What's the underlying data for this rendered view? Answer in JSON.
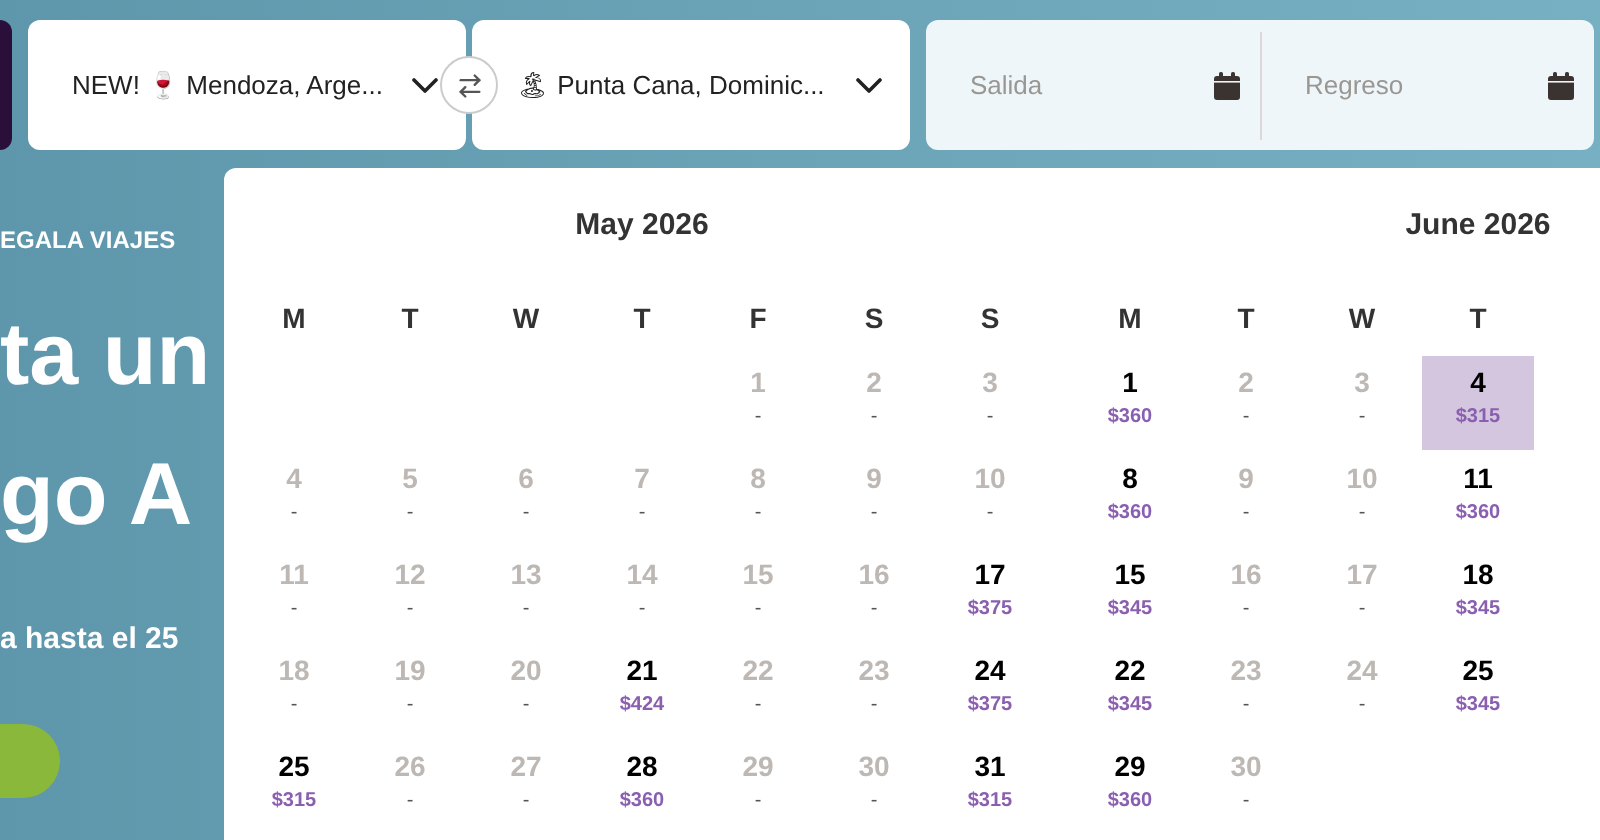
{
  "search": {
    "origin": {
      "label": "NEW! 🍷 Mendoza, Arge..."
    },
    "destination": {
      "label": "🏝 Punta Cana, Dominic..."
    },
    "departure": {
      "placeholder": "Salida"
    },
    "return": {
      "placeholder": "Regreso"
    }
  },
  "hero": {
    "eyebrow": "EGALA VIAJES",
    "headline_lines": [
      "ta un",
      "go A"
    ],
    "subtitle": "a hasta el 25"
  },
  "months": [
    {
      "title": "May 2026",
      "weekdays": [
        "M",
        "T",
        "W",
        "T",
        "F",
        "S",
        "S"
      ],
      "weeks": [
        [
          {
            "kind": "blank"
          },
          {
            "kind": "blank"
          },
          {
            "kind": "blank"
          },
          {
            "kind": "blank"
          },
          {
            "kind": "day",
            "day": "1",
            "price": "-",
            "available": false,
            "selected": false
          },
          {
            "kind": "day",
            "day": "2",
            "price": "-",
            "available": false,
            "selected": false
          },
          {
            "kind": "day",
            "day": "3",
            "price": "-",
            "available": false,
            "selected": false
          }
        ],
        [
          {
            "kind": "day",
            "day": "4",
            "price": "-",
            "available": false,
            "selected": false
          },
          {
            "kind": "day",
            "day": "5",
            "price": "-",
            "available": false,
            "selected": false
          },
          {
            "kind": "day",
            "day": "6",
            "price": "-",
            "available": false,
            "selected": false
          },
          {
            "kind": "day",
            "day": "7",
            "price": "-",
            "available": false,
            "selected": false
          },
          {
            "kind": "day",
            "day": "8",
            "price": "-",
            "available": false,
            "selected": false
          },
          {
            "kind": "day",
            "day": "9",
            "price": "-",
            "available": false,
            "selected": false
          },
          {
            "kind": "day",
            "day": "10",
            "price": "-",
            "available": false,
            "selected": false
          }
        ],
        [
          {
            "kind": "day",
            "day": "11",
            "price": "-",
            "available": false,
            "selected": false
          },
          {
            "kind": "day",
            "day": "12",
            "price": "-",
            "available": false,
            "selected": false
          },
          {
            "kind": "day",
            "day": "13",
            "price": "-",
            "available": false,
            "selected": false
          },
          {
            "kind": "day",
            "day": "14",
            "price": "-",
            "available": false,
            "selected": false
          },
          {
            "kind": "day",
            "day": "15",
            "price": "-",
            "available": false,
            "selected": false
          },
          {
            "kind": "day",
            "day": "16",
            "price": "-",
            "available": false,
            "selected": false
          },
          {
            "kind": "day",
            "day": "17",
            "price": "$375",
            "available": true,
            "selected": false
          }
        ],
        [
          {
            "kind": "day",
            "day": "18",
            "price": "-",
            "available": false,
            "selected": false
          },
          {
            "kind": "day",
            "day": "19",
            "price": "-",
            "available": false,
            "selected": false
          },
          {
            "kind": "day",
            "day": "20",
            "price": "-",
            "available": false,
            "selected": false
          },
          {
            "kind": "day",
            "day": "21",
            "price": "$424",
            "available": true,
            "selected": false
          },
          {
            "kind": "day",
            "day": "22",
            "price": "-",
            "available": false,
            "selected": false
          },
          {
            "kind": "day",
            "day": "23",
            "price": "-",
            "available": false,
            "selected": false
          },
          {
            "kind": "day",
            "day": "24",
            "price": "$375",
            "available": true,
            "selected": false
          }
        ],
        [
          {
            "kind": "day",
            "day": "25",
            "price": "$315",
            "available": true,
            "selected": false
          },
          {
            "kind": "day",
            "day": "26",
            "price": "-",
            "available": false,
            "selected": false
          },
          {
            "kind": "day",
            "day": "27",
            "price": "-",
            "available": false,
            "selected": false
          },
          {
            "kind": "day",
            "day": "28",
            "price": "$360",
            "available": true,
            "selected": false
          },
          {
            "kind": "day",
            "day": "29",
            "price": "-",
            "available": false,
            "selected": false
          },
          {
            "kind": "day",
            "day": "30",
            "price": "-",
            "available": false,
            "selected": false
          },
          {
            "kind": "day",
            "day": "31",
            "price": "$315",
            "available": true,
            "selected": false
          }
        ]
      ]
    },
    {
      "title": "June 2026",
      "weekdays": [
        "M",
        "T",
        "W",
        "T"
      ],
      "weeks": [
        [
          {
            "kind": "day",
            "day": "1",
            "price": "$360",
            "available": true,
            "selected": false
          },
          {
            "kind": "day",
            "day": "2",
            "price": "-",
            "available": false,
            "selected": false
          },
          {
            "kind": "day",
            "day": "3",
            "price": "-",
            "available": false,
            "selected": false
          },
          {
            "kind": "day",
            "day": "4",
            "price": "$315",
            "available": true,
            "selected": true
          }
        ],
        [
          {
            "kind": "day",
            "day": "8",
            "price": "$360",
            "available": true,
            "selected": false
          },
          {
            "kind": "day",
            "day": "9",
            "price": "-",
            "available": false,
            "selected": false
          },
          {
            "kind": "day",
            "day": "10",
            "price": "-",
            "available": false,
            "selected": false
          },
          {
            "kind": "day",
            "day": "11",
            "price": "$360",
            "available": true,
            "selected": false
          }
        ],
        [
          {
            "kind": "day",
            "day": "15",
            "price": "$345",
            "available": true,
            "selected": false
          },
          {
            "kind": "day",
            "day": "16",
            "price": "-",
            "available": false,
            "selected": false
          },
          {
            "kind": "day",
            "day": "17",
            "price": "-",
            "available": false,
            "selected": false
          },
          {
            "kind": "day",
            "day": "18",
            "price": "$345",
            "available": true,
            "selected": false
          }
        ],
        [
          {
            "kind": "day",
            "day": "22",
            "price": "$345",
            "available": true,
            "selected": false
          },
          {
            "kind": "day",
            "day": "23",
            "price": "-",
            "available": false,
            "selected": false
          },
          {
            "kind": "day",
            "day": "24",
            "price": "-",
            "available": false,
            "selected": false
          },
          {
            "kind": "day",
            "day": "25",
            "price": "$345",
            "available": true,
            "selected": false
          }
        ],
        [
          {
            "kind": "day",
            "day": "29",
            "price": "$360",
            "available": true,
            "selected": false
          },
          {
            "kind": "day",
            "day": "30",
            "price": "-",
            "available": false,
            "selected": false
          }
        ]
      ]
    }
  ]
}
